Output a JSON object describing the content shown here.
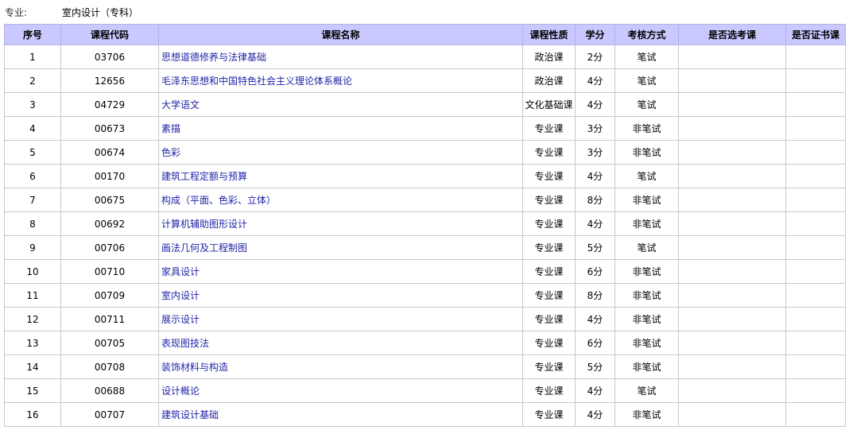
{
  "major": {
    "label": "专业:",
    "value": "室内设计（专科）"
  },
  "table": {
    "headers": [
      "序号",
      "课程代码",
      "课程名称",
      "课程性质",
      "学分",
      "考核方式",
      "是否选考课",
      "是否证书课"
    ],
    "rows": [
      {
        "no": "1",
        "code": "03706",
        "name": "思想道德修养与法律基础",
        "type": "政治课",
        "credits": "2分",
        "exam": "笔试",
        "elective": "",
        "certificate": ""
      },
      {
        "no": "2",
        "code": "12656",
        "name": "毛泽东思想和中国特色社会主义理论体系概论",
        "type": "政治课",
        "credits": "4分",
        "exam": "笔试",
        "elective": "",
        "certificate": ""
      },
      {
        "no": "3",
        "code": "04729",
        "name": "大学语文",
        "type": "文化基础课",
        "credits": "4分",
        "exam": "笔试",
        "elective": "",
        "certificate": ""
      },
      {
        "no": "4",
        "code": "00673",
        "name": "素描",
        "type": "专业课",
        "credits": "3分",
        "exam": "非笔试",
        "elective": "",
        "certificate": ""
      },
      {
        "no": "5",
        "code": "00674",
        "name": "色彩",
        "type": "专业课",
        "credits": "3分",
        "exam": "非笔试",
        "elective": "",
        "certificate": ""
      },
      {
        "no": "6",
        "code": "00170",
        "name": "建筑工程定额与预算",
        "type": "专业课",
        "credits": "4分",
        "exam": "笔试",
        "elective": "",
        "certificate": ""
      },
      {
        "no": "7",
        "code": "00675",
        "name": "构成（平面、色彩、立体）",
        "type": "专业课",
        "credits": "8分",
        "exam": "非笔试",
        "elective": "",
        "certificate": ""
      },
      {
        "no": "8",
        "code": "00692",
        "name": "计算机辅助图形设计",
        "type": "专业课",
        "credits": "4分",
        "exam": "非笔试",
        "elective": "",
        "certificate": ""
      },
      {
        "no": "9",
        "code": "00706",
        "name": "画法几何及工程制图",
        "type": "专业课",
        "credits": "5分",
        "exam": "笔试",
        "elective": "",
        "certificate": ""
      },
      {
        "no": "10",
        "code": "00710",
        "name": "家具设计",
        "type": "专业课",
        "credits": "6分",
        "exam": "非笔试",
        "elective": "",
        "certificate": ""
      },
      {
        "no": "11",
        "code": "00709",
        "name": "室内设计",
        "type": "专业课",
        "credits": "8分",
        "exam": "非笔试",
        "elective": "",
        "certificate": ""
      },
      {
        "no": "12",
        "code": "00711",
        "name": "展示设计",
        "type": "专业课",
        "credits": "4分",
        "exam": "非笔试",
        "elective": "",
        "certificate": ""
      },
      {
        "no": "13",
        "code": "00705",
        "name": "表现图技法",
        "type": "专业课",
        "credits": "6分",
        "exam": "非笔试",
        "elective": "",
        "certificate": ""
      },
      {
        "no": "14",
        "code": "00708",
        "name": "装饰材料与构造",
        "type": "专业课",
        "credits": "5分",
        "exam": "非笔试",
        "elective": "",
        "certificate": ""
      },
      {
        "no": "15",
        "code": "00688",
        "name": "设计概论",
        "type": "专业课",
        "credits": "4分",
        "exam": "笔试",
        "elective": "",
        "certificate": ""
      },
      {
        "no": "16",
        "code": "00707",
        "name": "建筑设计基础",
        "type": "专业课",
        "credits": "4分",
        "exam": "非笔试",
        "elective": "",
        "certificate": ""
      }
    ]
  }
}
